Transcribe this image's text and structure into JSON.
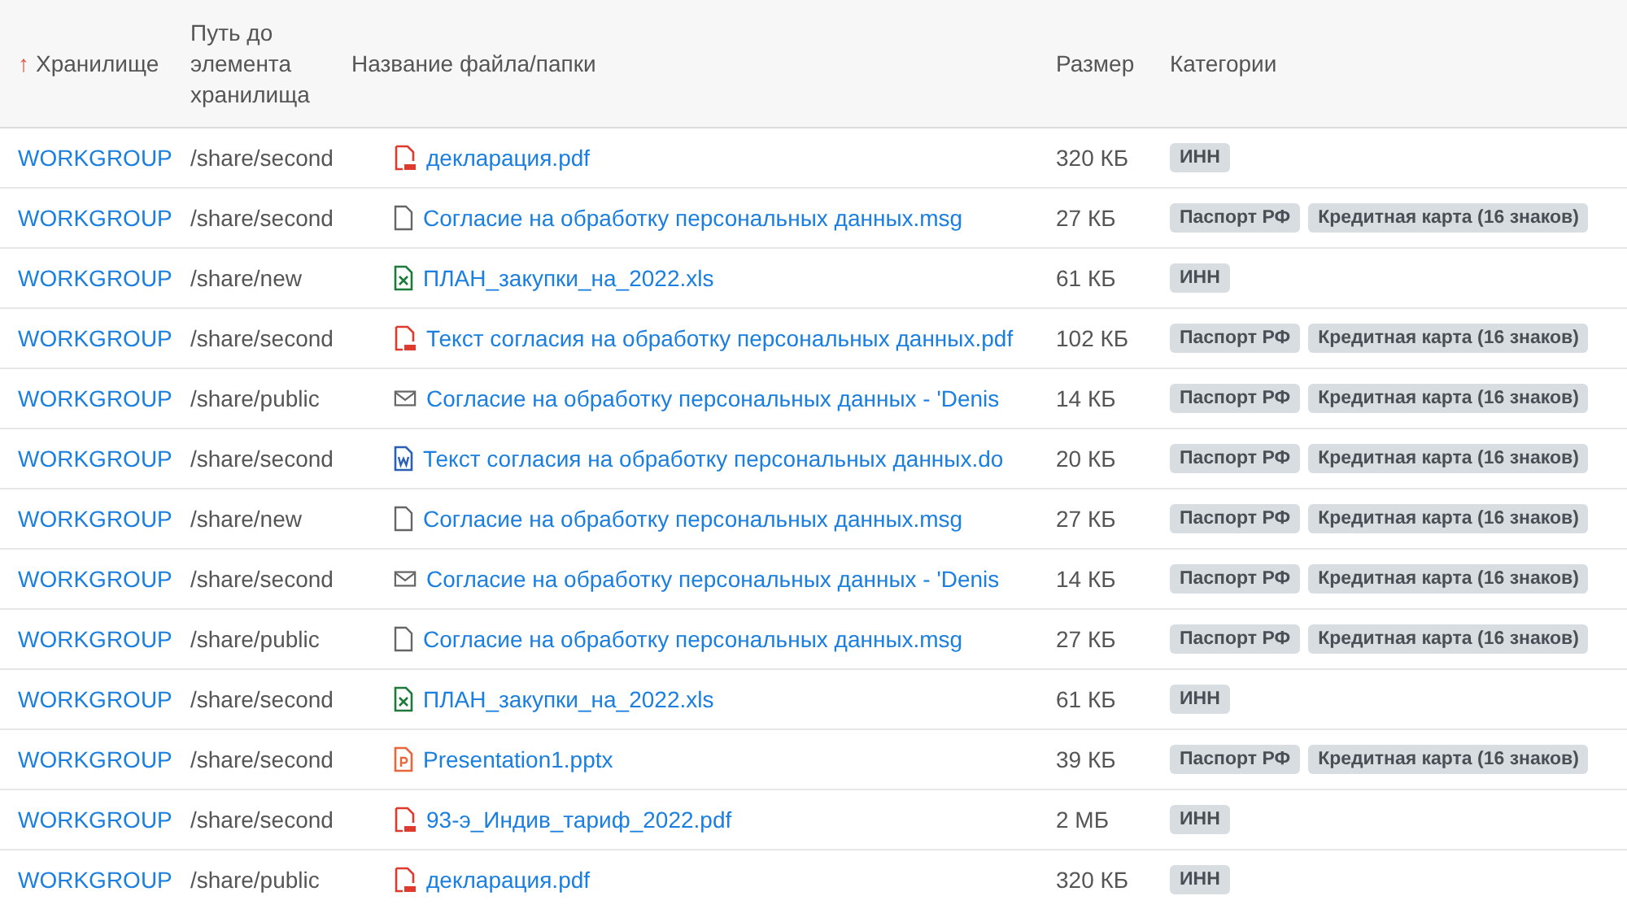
{
  "table": {
    "columns": [
      {
        "label": "Хранилище",
        "sort_mark": "↑"
      },
      {
        "label": "Путь до элемента хранилища"
      },
      {
        "label": "Название файла/папки"
      },
      {
        "label": "Размер"
      },
      {
        "label": "Категории"
      }
    ],
    "rows": [
      {
        "storage": "WORKGROUP",
        "path": "/share/second",
        "kind": "pdf",
        "name": "декларация.pdf",
        "size": "320 КБ",
        "categories": [
          "ИНН"
        ]
      },
      {
        "storage": "WORKGROUP",
        "path": "/share/second",
        "kind": "file",
        "name": "Согласие на обработку персональных данных.msg",
        "size": "27 КБ",
        "categories": [
          "Паспорт РФ",
          "Кредитная карта (16 знаков)"
        ]
      },
      {
        "storage": "WORKGROUP",
        "path": "/share/new",
        "kind": "xls",
        "name": "ПЛАН_закупки_на_2022.xls",
        "size": "61 КБ",
        "categories": [
          "ИНН"
        ]
      },
      {
        "storage": "WORKGROUP",
        "path": "/share/second",
        "kind": "pdf",
        "name": "Текст согласия на обработку персональных данных.pdf",
        "size": "102 КБ",
        "categories": [
          "Паспорт РФ",
          "Кредитная карта (16 знаков)"
        ]
      },
      {
        "storage": "WORKGROUP",
        "path": "/share/public",
        "kind": "mail",
        "name": "Согласие на обработку персональных данных - 'Denis",
        "size": "14 КБ",
        "categories": [
          "Паспорт РФ",
          "Кредитная карта (16 знаков)"
        ]
      },
      {
        "storage": "WORKGROUP",
        "path": "/share/second",
        "kind": "doc",
        "name": "Текст согласия на обработку персональных данных.do",
        "size": "20 КБ",
        "categories": [
          "Паспорт РФ",
          "Кредитная карта (16 знаков)"
        ]
      },
      {
        "storage": "WORKGROUP",
        "path": "/share/new",
        "kind": "file",
        "name": "Согласие на обработку персональных данных.msg",
        "size": "27 КБ",
        "categories": [
          "Паспорт РФ",
          "Кредитная карта (16 знаков)"
        ]
      },
      {
        "storage": "WORKGROUP",
        "path": "/share/second",
        "kind": "mail",
        "name": "Согласие на обработку персональных данных - 'Denis",
        "size": "14 КБ",
        "categories": [
          "Паспорт РФ",
          "Кредитная карта (16 знаков)"
        ]
      },
      {
        "storage": "WORKGROUP",
        "path": "/share/public",
        "kind": "file",
        "name": "Согласие на обработку персональных данных.msg",
        "size": "27 КБ",
        "categories": [
          "Паспорт РФ",
          "Кредитная карта (16 знаков)"
        ]
      },
      {
        "storage": "WORKGROUP",
        "path": "/share/second",
        "kind": "xls",
        "name": "ПЛАН_закупки_на_2022.xls",
        "size": "61 КБ",
        "categories": [
          "ИНН"
        ]
      },
      {
        "storage": "WORKGROUP",
        "path": "/share/second",
        "kind": "ppt",
        "name": "Presentation1.pptx",
        "size": "39 КБ",
        "categories": [
          "Паспорт РФ",
          "Кредитная карта (16 знаков)"
        ]
      },
      {
        "storage": "WORKGROUP",
        "path": "/share/second",
        "kind": "pdf",
        "name": "93-э_Индив_тариф_2022.pdf",
        "size": "2 МБ",
        "categories": [
          "ИНН"
        ]
      },
      {
        "storage": "WORKGROUP",
        "path": "/share/public",
        "kind": "pdf",
        "name": "декларация.pdf",
        "size": "320 КБ",
        "categories": [
          "ИНН"
        ]
      }
    ]
  }
}
